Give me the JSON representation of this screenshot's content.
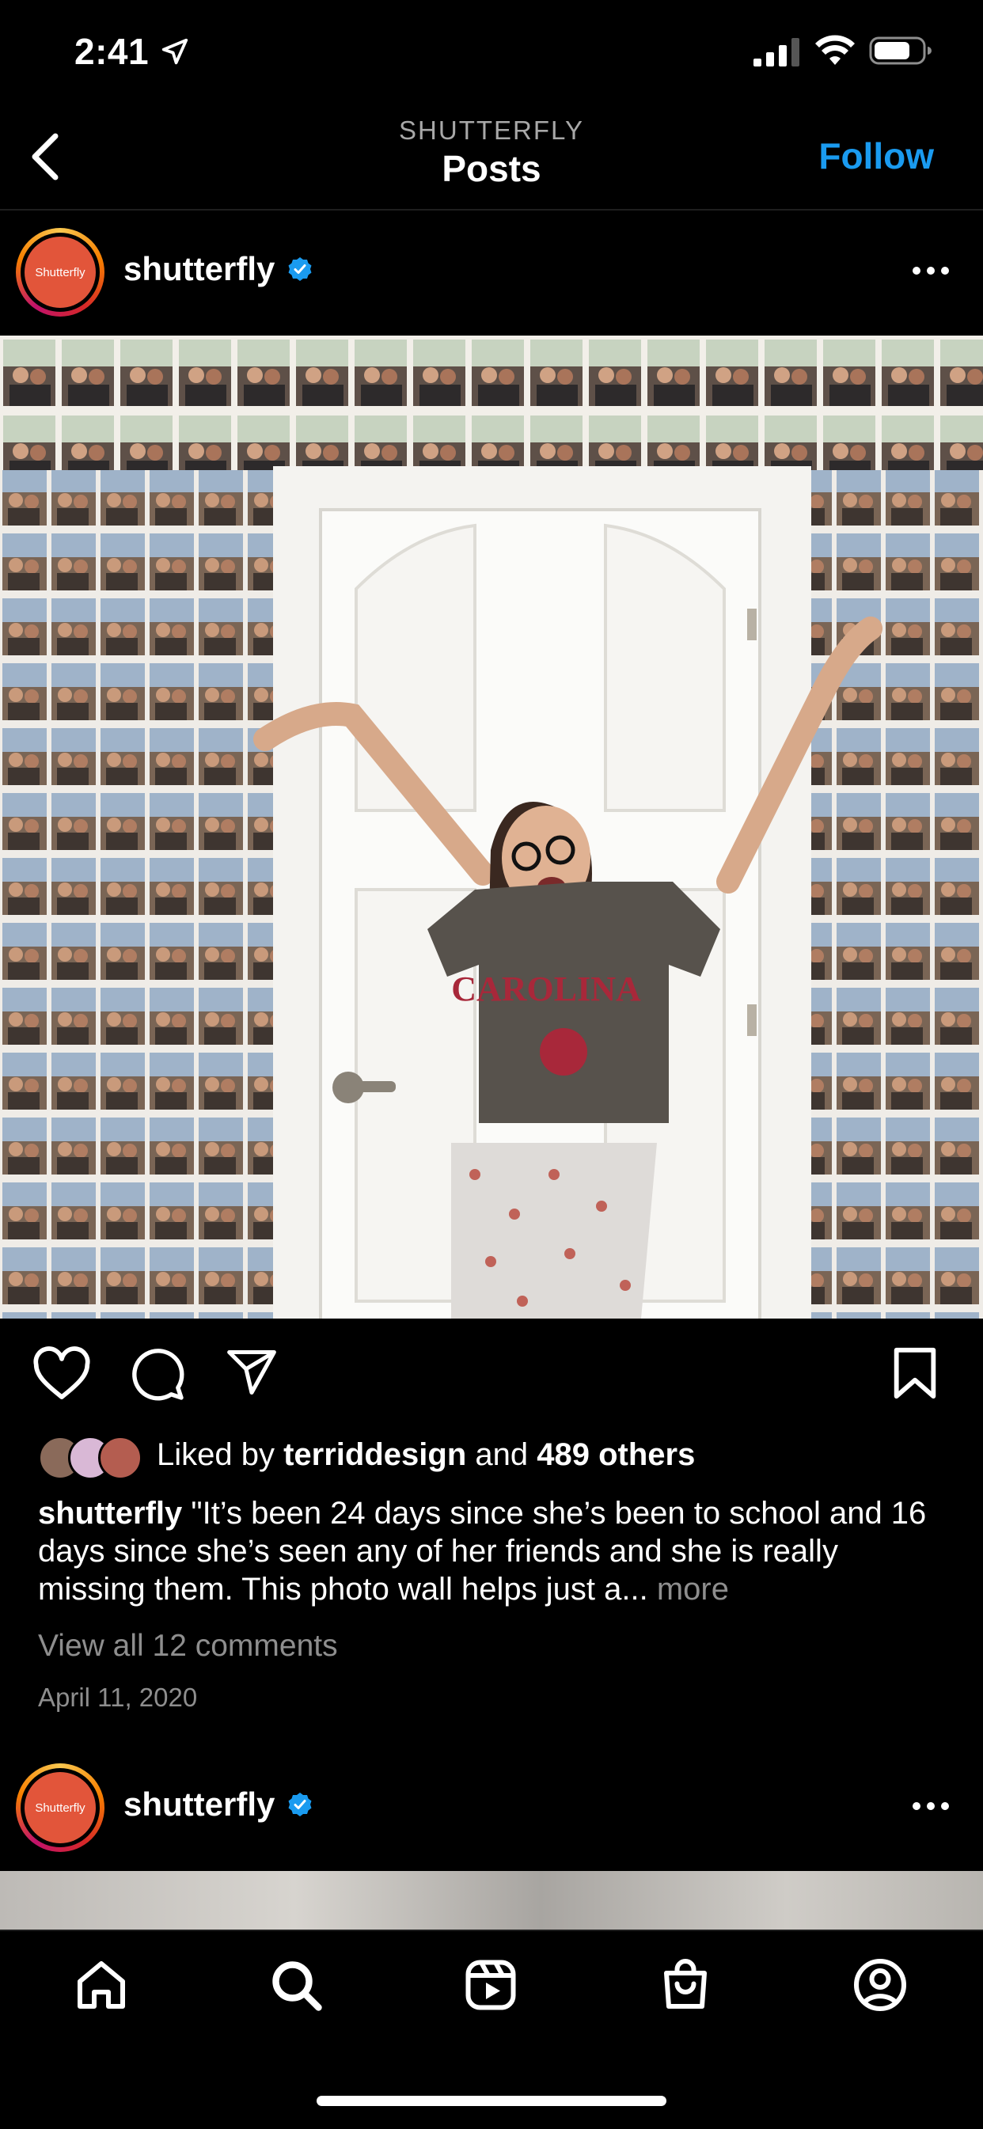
{
  "status_bar": {
    "time": "2:41"
  },
  "header": {
    "account_label": "SHUTTERFLY",
    "title": "Posts",
    "follow_label": "Follow"
  },
  "post": {
    "avatar_text": "Shutterfly",
    "username": "shutterfly",
    "verified": true,
    "liked_by_prefix": "Liked by",
    "liked_by_user": "terriddesign",
    "liked_by_and": "and",
    "liked_by_others": "489 others",
    "caption_user": "shutterfly",
    "caption_text": "\"It’s been 24 days since she’s been to school and 16 days since she’s seen any of her friends and she is really missing them. This photo wall helps just a...",
    "more_label": "more",
    "view_comments": "View all 12 comments",
    "date": "April 11, 2020"
  },
  "next_post": {
    "avatar_text": "Shutterfly",
    "username": "shutterfly",
    "verified": true
  },
  "colors": {
    "accent": "#1a9bf0",
    "avatar_bg": "#e2553a",
    "verified": "#1a9bf0"
  },
  "icons": [
    "back-chevron-icon",
    "location-arrow-icon",
    "signal-icon",
    "wifi-icon",
    "battery-icon",
    "more-dots-icon",
    "heart-icon",
    "comment-icon",
    "share-icon",
    "bookmark-icon",
    "home-icon",
    "search-icon",
    "reels-icon",
    "shop-icon",
    "profile-icon"
  ]
}
